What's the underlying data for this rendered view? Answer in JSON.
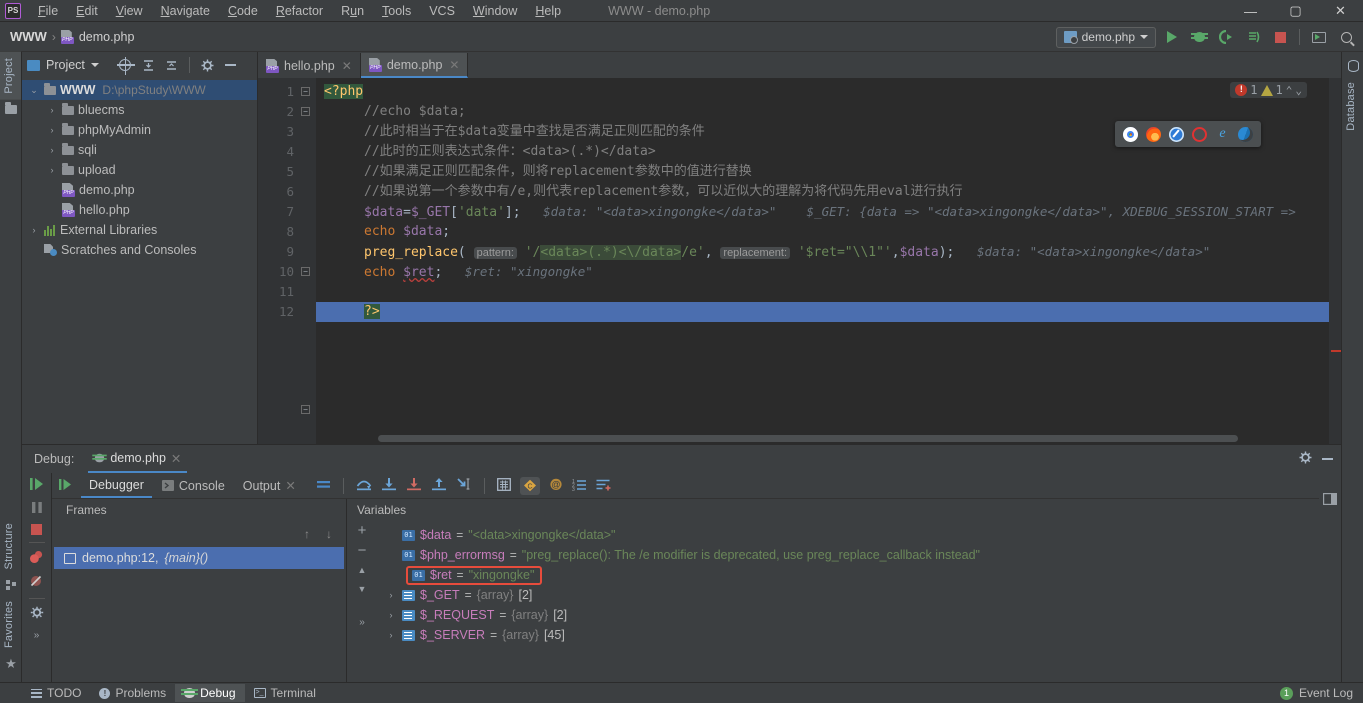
{
  "titlebar": {
    "logo": "PS",
    "menus": [
      "File",
      "Edit",
      "View",
      "Navigate",
      "Code",
      "Refactor",
      "Run",
      "Tools",
      "VCS",
      "Window",
      "Help"
    ],
    "window_title": "WWW - demo.php",
    "minimize": "—",
    "maximize": "▢",
    "close": "✕"
  },
  "navbar": {
    "project_crumb": "WWW",
    "separator": "›",
    "file_crumb": "demo.php",
    "run_config": "demo.php",
    "icons": [
      "run-icon",
      "debug-icon",
      "debug-with-coverage-icon",
      "profile-icon",
      "stop-icon",
      "screen-icon",
      "search-everywhere-icon"
    ]
  },
  "left_strip": {
    "project_tab": "Project",
    "structure_tab": "Structure",
    "favorites_tab": "Favorites"
  },
  "right_strip": {
    "database_tab": "Database"
  },
  "project": {
    "header": "Project",
    "tree": [
      {
        "indent": 0,
        "arrow": "⌄",
        "icon": "folder-icon",
        "label": "WWW",
        "path": "D:\\phpStudy\\WWW",
        "selected": true,
        "bold": true
      },
      {
        "indent": 1,
        "arrow": "›",
        "icon": "folder-icon",
        "label": "bluecms",
        "path": "",
        "selected": false,
        "bold": false
      },
      {
        "indent": 1,
        "arrow": "›",
        "icon": "folder-icon",
        "label": "phpMyAdmin",
        "path": "",
        "selected": false,
        "bold": false
      },
      {
        "indent": 1,
        "arrow": "›",
        "icon": "folder-icon",
        "label": "sqli",
        "path": "",
        "selected": false,
        "bold": false
      },
      {
        "indent": 1,
        "arrow": "›",
        "icon": "folder-icon",
        "label": "upload",
        "path": "",
        "selected": false,
        "bold": false
      },
      {
        "indent": 1,
        "arrow": "",
        "icon": "php-file-icon",
        "label": "demo.php",
        "path": "",
        "selected": false,
        "bold": false
      },
      {
        "indent": 1,
        "arrow": "",
        "icon": "php-file-icon",
        "label": "hello.php",
        "path": "",
        "selected": false,
        "bold": false
      },
      {
        "indent": 0,
        "arrow": "›",
        "icon": "library-icon",
        "label": "External Libraries",
        "path": "",
        "selected": false,
        "bold": false
      },
      {
        "indent": 0,
        "arrow": "",
        "icon": "scratches-icon",
        "label": "Scratches and Consoles",
        "path": "",
        "selected": false,
        "bold": false
      }
    ]
  },
  "editor": {
    "tabs": [
      {
        "label": "hello.php",
        "active": false,
        "close": "✕"
      },
      {
        "label": "demo.php",
        "active": true,
        "close": "✕"
      }
    ],
    "line_numbers": [
      "1",
      "2",
      "3",
      "4",
      "5",
      "6",
      "7",
      "8",
      "9",
      "10",
      "11",
      "12"
    ],
    "inspections": {
      "error_count": "1",
      "warning_count": "1",
      "up": "⌃",
      "down": "⌄"
    },
    "browser_popup": [
      "chrome-icon",
      "firefox-icon",
      "safari-icon",
      "opera-icon",
      "ie-icon",
      "edge-icon"
    ],
    "code": {
      "l1_php_open": "<?php",
      "l2": "//echo $data;",
      "l3": "//此时相当于在$data变量中查找是否满足正则匹配的条件",
      "l4": "//此时的正则表达式条件：<data>(.*)</data>",
      "l5": "//如果满足正则匹配条件，则将replacement参数中的值进行替换",
      "l6": "//如果说第一个参数中有/e,则代表replacement参数，可以近似大的理解为将代码先用eval进行执行",
      "l7_var": "$data",
      "l7_assign": "=",
      "l7_get": "$_GET",
      "l7_key": "'data'",
      "l7_hint1": "$data: \"<data>xingongke</data>\"",
      "l7_hint2": "$_GET: {data => \"<data>xingongke</data>\", XDEBUG_SESSION_START =>",
      "l8_echo": "echo",
      "l8_var": "$data",
      "l9_fn": "preg_replace",
      "l9_p1label": "pattern:",
      "l9_pattern_pre": "'/",
      "l9_pattern_hl": "<data>(.*)<\\/data>",
      "l9_pattern_post": "/e'",
      "l9_p2label": "replacement:",
      "l9_repl": "'$ret=\"\\\\1\"'",
      "l9_arg3": "$data",
      "l9_hint": "$data: \"<data>xingongke</data>\"",
      "l10_echo": "echo",
      "l10_var": "$ret",
      "l10_hint": "$ret: \"xingongke\"",
      "l12_php_close": "?>"
    }
  },
  "debug": {
    "title_label": "Debug:",
    "session_tab": "demo.php",
    "session_close": "✕",
    "settings_icon": "gear-icon",
    "hide_icon": "minimize-icon",
    "tabs": [
      {
        "label": "Debugger",
        "active": true
      },
      {
        "label": "Console",
        "active": false
      },
      {
        "label": "Output",
        "active": false,
        "close": "✕"
      }
    ],
    "tool_icons": [
      "show-execution-point-icon",
      "step-over-icon",
      "step-into-icon",
      "force-step-into-icon",
      "step-out-icon",
      "run-to-cursor-icon",
      "evaluate-expression-icon",
      "watches-icon",
      "mute-breakpoints-icon",
      "sort-icon",
      "settings-icon"
    ],
    "frames": {
      "header": "Frames",
      "up_arrow": "↑",
      "down_arrow": "↓",
      "items": [
        {
          "label": "demo.php:12,",
          "func": "{main}()",
          "selected": true
        }
      ]
    },
    "variables": {
      "header": "Variables",
      "add": "+",
      "remove": "−",
      "up": "▲",
      "down": "▼",
      "more": "»",
      "rows": [
        {
          "expand": "",
          "icon": "primitive-icon",
          "name": "$data",
          "eq": "=",
          "value": "\"<data>xingongke</data>\"",
          "type": "",
          "count": "",
          "highlighted": false
        },
        {
          "expand": "",
          "icon": "primitive-icon",
          "name": "$php_errormsg",
          "eq": "=",
          "value": "\"preg_replace(): The /e modifier is deprecated, use preg_replace_callback instead\"",
          "type": "",
          "count": "",
          "highlighted": false
        },
        {
          "expand": "",
          "icon": "primitive-icon",
          "name": "$ret",
          "eq": "=",
          "value": "\"xingongke\"",
          "type": "",
          "count": "",
          "highlighted": true
        },
        {
          "expand": "›",
          "icon": "array-icon",
          "name": "$_GET",
          "eq": "=",
          "value": "",
          "type": "{array}",
          "count": "[2]",
          "highlighted": false
        },
        {
          "expand": "›",
          "icon": "array-icon",
          "name": "$_REQUEST",
          "eq": "=",
          "value": "",
          "type": "{array}",
          "count": "[2]",
          "highlighted": false
        },
        {
          "expand": "›",
          "icon": "array-icon",
          "name": "$_SERVER",
          "eq": "=",
          "value": "",
          "type": "{array}",
          "count": "[45]",
          "highlighted": false
        }
      ]
    },
    "side_icons": [
      "resume-icon",
      "pause-icon",
      "stop-icon",
      "view-breakpoints-icon",
      "mute-breakpoints-icon",
      "settings-icon",
      "more-icon"
    ]
  },
  "status": {
    "buttons": [
      {
        "label": "TODO",
        "icon": "todo-icon",
        "active": false
      },
      {
        "label": "Problems",
        "icon": "problems-icon",
        "active": false
      },
      {
        "label": "Debug",
        "icon": "debug-icon",
        "active": true
      },
      {
        "label": "Terminal",
        "icon": "terminal-icon",
        "active": false
      }
    ],
    "event_log": "Event Log",
    "event_count": "1"
  },
  "colors": {
    "accent_blue": "#4a88c7",
    "selection_blue": "#4b6eaf",
    "run_green": "#59a869",
    "stop_red": "#c75450",
    "highlight_red": "#e74c3c",
    "string_green": "#6a8759",
    "keyword_orange": "#cc7832",
    "variable_purple": "#9876aa"
  }
}
